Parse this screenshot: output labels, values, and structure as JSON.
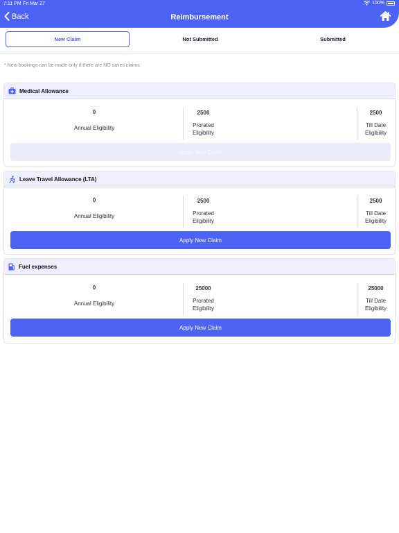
{
  "status_bar": {
    "time": "7:11 PM",
    "date": "Fri Mar 27",
    "battery": "100%"
  },
  "header": {
    "back_label": "Back",
    "title": "Reimbursement"
  },
  "tabs": [
    {
      "label": "New Claim",
      "active": true
    },
    {
      "label": "Not Submitted",
      "active": false
    },
    {
      "label": "Submitted",
      "active": false
    }
  ],
  "note": "* New bookings can be made only if there are NO saves claims",
  "cards": [
    {
      "title": "Medical Allowance",
      "icon": "medical-kit-icon",
      "annual_value": "0",
      "annual_label": "Annual Eligibility",
      "prorated_value": "2500",
      "prorated_label_1": "Prorated",
      "prorated_label_2": "Eligibility",
      "till_value": "2500",
      "till_label_1": "Till Date",
      "till_label_2": "Eligibility",
      "button_label": "Apply New Claim",
      "button_enabled": false
    },
    {
      "title": "Leave Travel Allowance (LTA)",
      "icon": "walking-person-icon",
      "annual_value": "0",
      "annual_label": "Annual Eligibility",
      "prorated_value": "2500",
      "prorated_label_1": "Prorated",
      "prorated_label_2": "Eligibility",
      "till_value": "2500",
      "till_label_1": "Till Date",
      "till_label_2": "Eligibility",
      "button_label": "Apply New Claim",
      "button_enabled": true
    },
    {
      "title": "Fuel expenses",
      "icon": "fuel-pump-icon",
      "annual_value": "0",
      "annual_label": "Annual Eligibility",
      "prorated_value": "25000",
      "prorated_label_1": "Prorated",
      "prorated_label_2": "Eligibility",
      "till_value": "25000",
      "till_label_1": "Till Date",
      "till_label_2": "Eligibility",
      "button_label": "Apply New Claim",
      "button_enabled": true
    }
  ],
  "colors": {
    "accent": "#4d63f5",
    "card_header": "#eeeefe",
    "disabled_button": "#ebebfa"
  }
}
